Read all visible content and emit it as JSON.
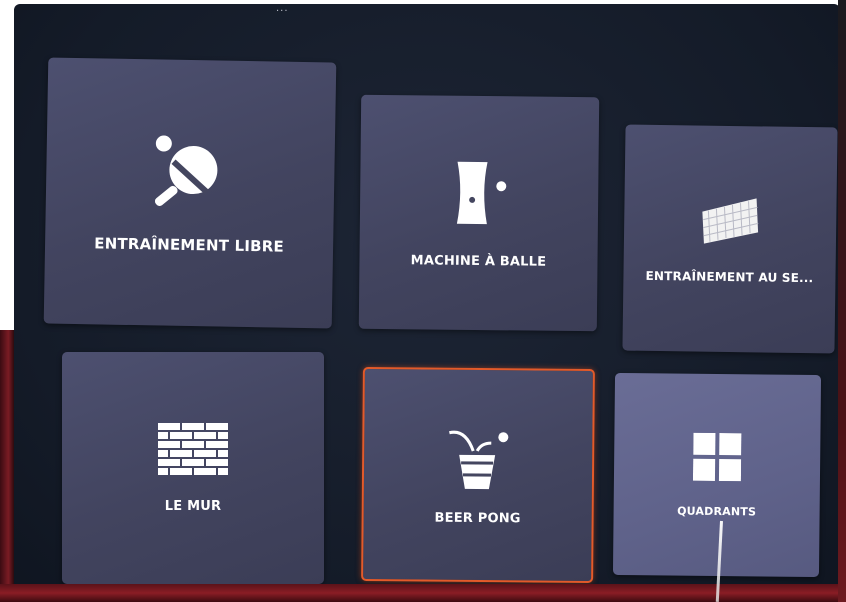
{
  "header": {
    "title_fragment": "..."
  },
  "tiles": [
    {
      "label": "ENTRAÎNEMENT LIBRE",
      "icon": "ping-pong-paddle-icon"
    },
    {
      "label": "MACHINE À BALLE",
      "icon": "ball-machine-icon"
    },
    {
      "label": "ENTRAÎNEMENT AU SE...",
      "icon": "net-icon"
    },
    {
      "label": "LE MUR",
      "icon": "brick-wall-icon"
    },
    {
      "label": "BEER PONG",
      "icon": "beer-pong-cup-icon",
      "state": "selected"
    },
    {
      "label": "QUADRANTS",
      "icon": "quadrants-grid-icon",
      "state": "hovered"
    }
  ],
  "colors": {
    "panel_background": "#141b28",
    "tile_background": "#45475f",
    "tile_hover_background": "#5f628a",
    "selected_border": "#e35a2a",
    "label_text": "#ffffff",
    "frame_red": "#7a1c24"
  }
}
